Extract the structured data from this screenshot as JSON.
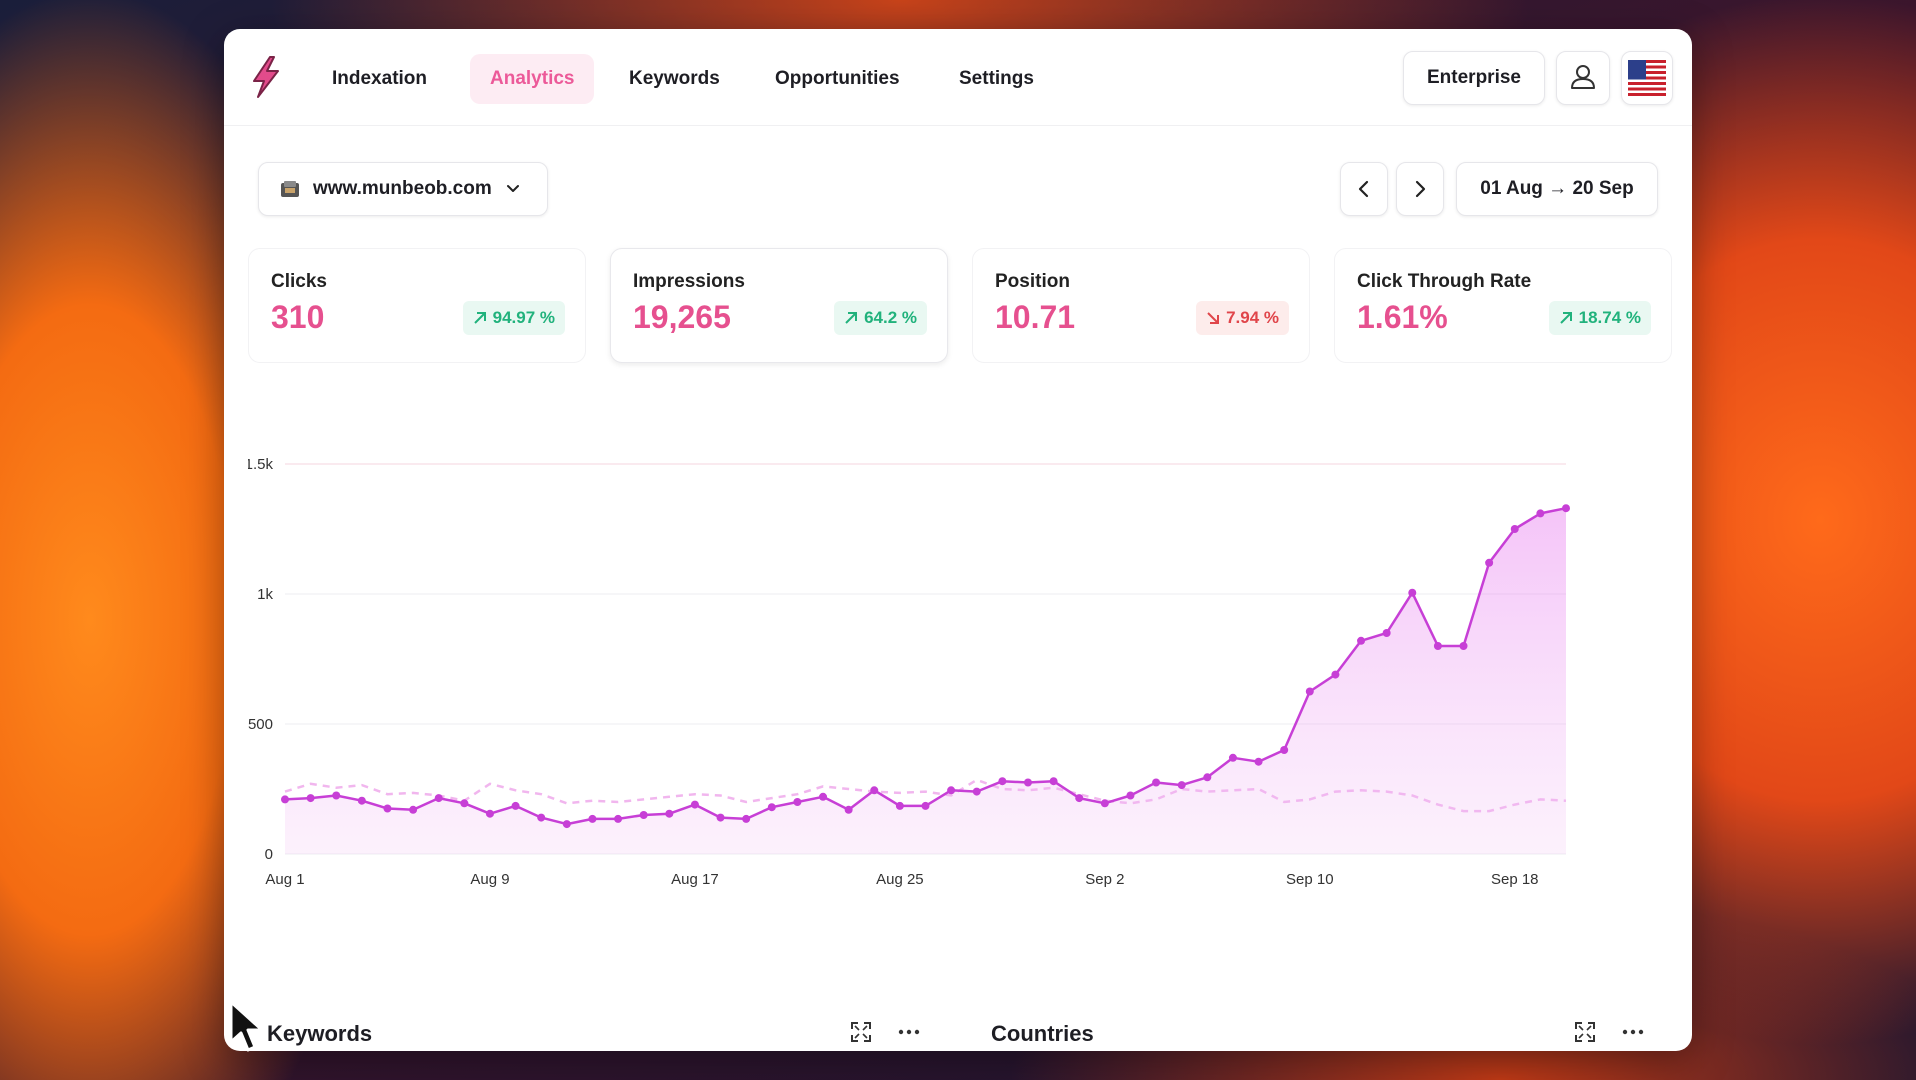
{
  "nav": {
    "items": [
      "Indexation",
      "Analytics",
      "Keywords",
      "Opportunities",
      "Settings"
    ],
    "active": "Analytics",
    "plan_label": "Enterprise"
  },
  "toolbar": {
    "site": "www.munbeob.com",
    "date_range": "01 Aug → 20 Sep"
  },
  "stats": [
    {
      "label": "Clicks",
      "value": "310",
      "change": "94.97 %",
      "direction": "up"
    },
    {
      "label": "Impressions",
      "value": "19,265",
      "change": "64.2 %",
      "direction": "up"
    },
    {
      "label": "Position",
      "value": "10.71",
      "change": "7.94 %",
      "direction": "down"
    },
    {
      "label": "Click Through Rate",
      "value": "1.61%",
      "change": "18.74 %",
      "direction": "up"
    }
  ],
  "chart_data": {
    "type": "area",
    "x": [
      "Aug 1",
      "Aug 2",
      "Aug 3",
      "Aug 4",
      "Aug 5",
      "Aug 6",
      "Aug 7",
      "Aug 8",
      "Aug 9",
      "Aug 10",
      "Aug 11",
      "Aug 12",
      "Aug 13",
      "Aug 14",
      "Aug 15",
      "Aug 16",
      "Aug 17",
      "Aug 18",
      "Aug 19",
      "Aug 20",
      "Aug 21",
      "Aug 22",
      "Aug 23",
      "Aug 24",
      "Aug 25",
      "Aug 26",
      "Aug 27",
      "Aug 28",
      "Aug 29",
      "Aug 30",
      "Aug 31",
      "Sep 1",
      "Sep 2",
      "Sep 3",
      "Sep 4",
      "Sep 5",
      "Sep 6",
      "Sep 7",
      "Sep 8",
      "Sep 9",
      "Sep 10",
      "Sep 11",
      "Sep 12",
      "Sep 13",
      "Sep 14",
      "Sep 15",
      "Sep 16",
      "Sep 17",
      "Sep 18",
      "Sep 19",
      "Sep 20"
    ],
    "x_ticks": [
      "Aug 1",
      "Aug 9",
      "Aug 17",
      "Aug 25",
      "Sep 2",
      "Sep 10",
      "Sep 18"
    ],
    "y_ticks": [
      "0",
      "500",
      "1k",
      "1.5k"
    ],
    "ylim": [
      0,
      1500
    ],
    "series": [
      {
        "values": [
          210,
          215,
          225,
          205,
          175,
          170,
          215,
          195,
          155,
          185,
          140,
          115,
          135,
          135,
          150,
          155,
          190,
          140,
          135,
          180,
          200,
          220,
          170,
          245,
          185,
          185,
          245,
          240,
          280,
          275,
          280,
          215,
          195,
          225,
          275,
          265,
          295,
          370,
          355,
          400,
          625,
          690,
          820,
          850,
          1005,
          800,
          800,
          1120,
          1250,
          1310,
          1330
        ]
      },
      {
        "values": [
          240,
          270,
          255,
          265,
          230,
          235,
          225,
          205,
          270,
          245,
          230,
          195,
          205,
          200,
          210,
          220,
          230,
          225,
          200,
          215,
          230,
          260,
          250,
          240,
          235,
          240,
          225,
          285,
          250,
          245,
          255,
          230,
          205,
          195,
          210,
          250,
          240,
          245,
          250,
          200,
          210,
          240,
          245,
          240,
          225,
          190,
          165,
          165,
          190,
          210,
          205
        ]
      }
    ]
  }
}
